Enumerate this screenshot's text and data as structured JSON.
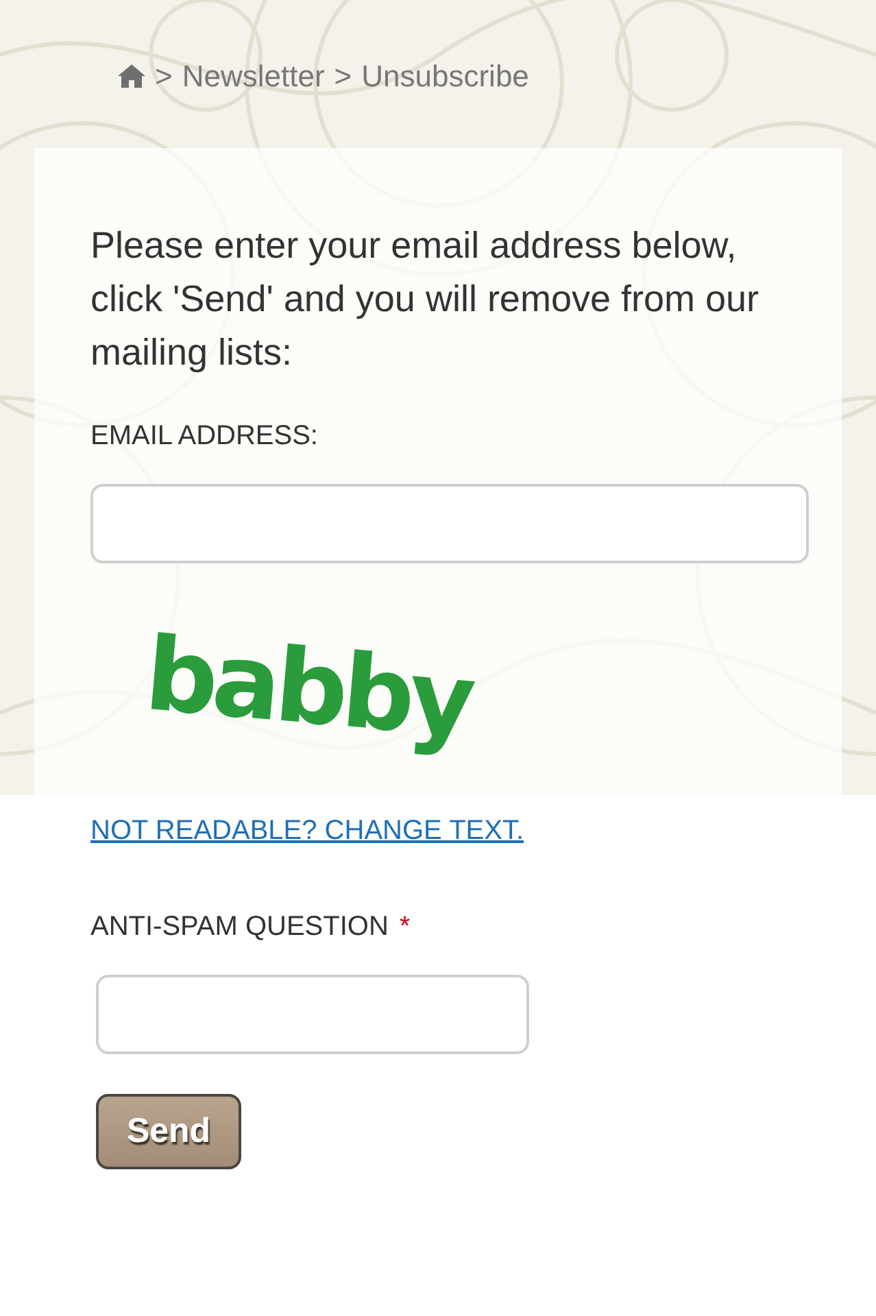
{
  "breadcrumb": [
    {
      "kind": "home"
    },
    {
      "kind": "separator",
      "text": ">"
    },
    {
      "kind": "link",
      "label": "Newsletter"
    },
    {
      "kind": "separator",
      "text": ">"
    },
    {
      "kind": "current",
      "label": "Unsubscribe"
    }
  ],
  "intro": "Please enter your email address below, click 'Send' and you will remove from our mailing lists:",
  "email_field": {
    "label": "EMAIL ADDRESS:"
  },
  "captcha": {
    "text": "babby",
    "link": "NOT READABLE? CHANGE TEXT."
  },
  "antispam_field": {
    "label": "ANTI-SPAM QUESTION",
    "required_mark": "*"
  },
  "buttons": [
    {
      "label": "Send"
    }
  ]
}
